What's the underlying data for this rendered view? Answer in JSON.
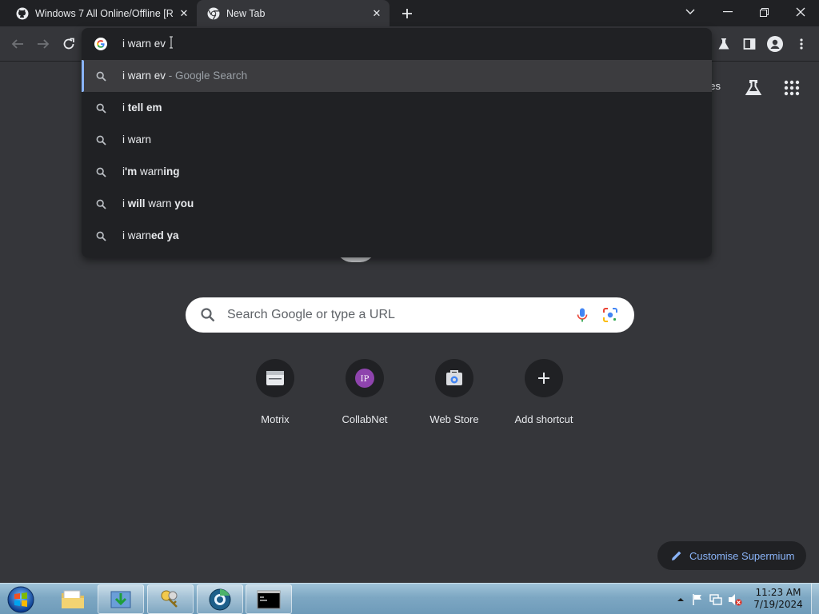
{
  "tabs": [
    {
      "title": "Windows 7 All Online/Offline [R",
      "favicon": "github-icon",
      "active": false
    },
    {
      "title": "New Tab",
      "favicon": "chromium-icon",
      "active": true
    }
  ],
  "omnibox": {
    "input_text": "i warn ev",
    "suggestions": [
      {
        "parts": [
          {
            "text": "i warn ev",
            "bold": false
          }
        ],
        "description": " - Google Search",
        "selected": true
      },
      {
        "parts": [
          {
            "text": "i ",
            "bold": false
          },
          {
            "text": "tell em",
            "bold": true
          }
        ],
        "description": "",
        "selected": false
      },
      {
        "parts": [
          {
            "text": "i warn",
            "bold": false
          }
        ],
        "description": "",
        "selected": false
      },
      {
        "parts": [
          {
            "text": "i",
            "bold": false
          },
          {
            "text": "'m",
            "bold": true
          },
          {
            "text": " warn",
            "bold": false
          },
          {
            "text": "ing",
            "bold": true
          }
        ],
        "description": "",
        "selected": false
      },
      {
        "parts": [
          {
            "text": "i ",
            "bold": false
          },
          {
            "text": "will",
            "bold": true
          },
          {
            "text": " warn ",
            "bold": false
          },
          {
            "text": "you",
            "bold": true
          }
        ],
        "description": "",
        "selected": false
      },
      {
        "parts": [
          {
            "text": "i warn",
            "bold": false
          },
          {
            "text": "ed ya",
            "bold": true
          }
        ],
        "description": "",
        "selected": false
      }
    ]
  },
  "ntp": {
    "images_link": "ges",
    "search_placeholder": "Search Google or type a URL",
    "shortcuts": [
      {
        "label": "Motrix",
        "icon": "motrix-icon"
      },
      {
        "label": "CollabNet",
        "icon": "collabnet-icon"
      },
      {
        "label": "Web Store",
        "icon": "web-store-icon"
      },
      {
        "label": "Add shortcut",
        "icon": "plus-icon"
      }
    ],
    "customise_label": "Customise Supermium"
  },
  "taskbar": {
    "clock_time": "11:23 AM",
    "clock_date": "7/19/2024"
  },
  "colors": {
    "background": "#35363a",
    "popup": "#202124",
    "accent": "#8ab4f8",
    "selected_row": "#3c3c3f"
  }
}
